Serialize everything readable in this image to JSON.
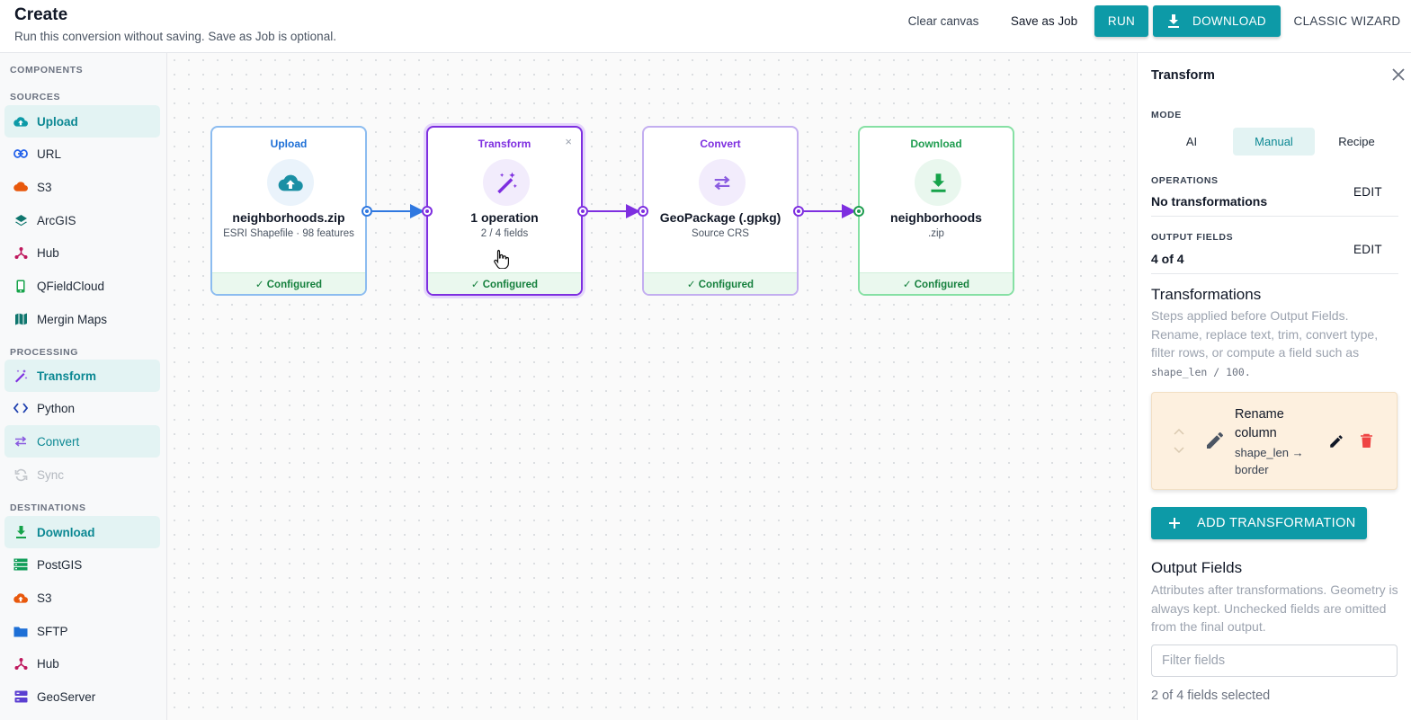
{
  "header": {
    "title": "Create",
    "subtitle": "Run this conversion without saving. Save as Job is optional.",
    "clear_canvas": "Clear canvas",
    "save_as_job": "Save as Job",
    "run": "RUN",
    "download": "DOWNLOAD",
    "classic_wizard": "CLASSIC WIZARD"
  },
  "sidebar": {
    "components_label": "COMPONENTS",
    "sources_label": "SOURCES",
    "processing_label": "PROCESSING",
    "destinations_label": "DESTINATIONS",
    "sources": [
      "Upload",
      "URL",
      "S3",
      "ArcGIS",
      "Hub",
      "QFieldCloud",
      "Mergin Maps"
    ],
    "processing": [
      "Transform",
      "Python",
      "Convert",
      "Sync"
    ],
    "destinations": [
      "Download",
      "PostGIS",
      "S3",
      "SFTP",
      "Hub",
      "GeoServer"
    ]
  },
  "nodes": [
    {
      "type": "Upload",
      "name": "neighborhoods.zip",
      "sub": "ESRI Shapefile · 98 features",
      "status": "✓ Configured"
    },
    {
      "type": "Transform",
      "name": "1 operation",
      "sub": "2 / 4 fields",
      "status": "✓ Configured",
      "close": "×"
    },
    {
      "type": "Convert",
      "name": "GeoPackage (.gpkg)",
      "sub": "Source CRS",
      "status": "✓ Configured"
    },
    {
      "type": "Download",
      "name": "neighborhoods",
      "sub": ".zip",
      "status": "✓ Configured"
    }
  ],
  "panel": {
    "title": "Transform",
    "mode_label": "MODE",
    "modes": [
      "AI",
      "Manual",
      "Recipe"
    ],
    "selected_mode": "Manual",
    "operations_label": "OPERATIONS",
    "operations_value": "No transformations",
    "output_fields_label": "OUTPUT FIELDS",
    "output_fields_value": "4 of 4",
    "edit": "EDIT",
    "transformations_heading": "Transformations",
    "transformations_desc": "Steps applied before Output Fields. Rename, replace text, trim, convert type, filter rows, or compute a field such as",
    "transformations_code": "shape_len / 100.",
    "card_title": "Rename column",
    "card_detail": "shape_len → border",
    "add_transformation": "ADD TRANSFORMATION",
    "output_heading": "Output Fields",
    "output_desc": "Attributes after transformations. Geometry is always kept. Unchecked fields are omitted from the final output.",
    "filter_placeholder": "Filter fields",
    "fields_selected": "2 of 4 fields selected"
  },
  "colors": {
    "accent": "#0d9aa7",
    "upload": "#1d6fd6",
    "transform": "#7e2fe0",
    "convert": "#8a5be0",
    "download": "#1f9d50"
  }
}
